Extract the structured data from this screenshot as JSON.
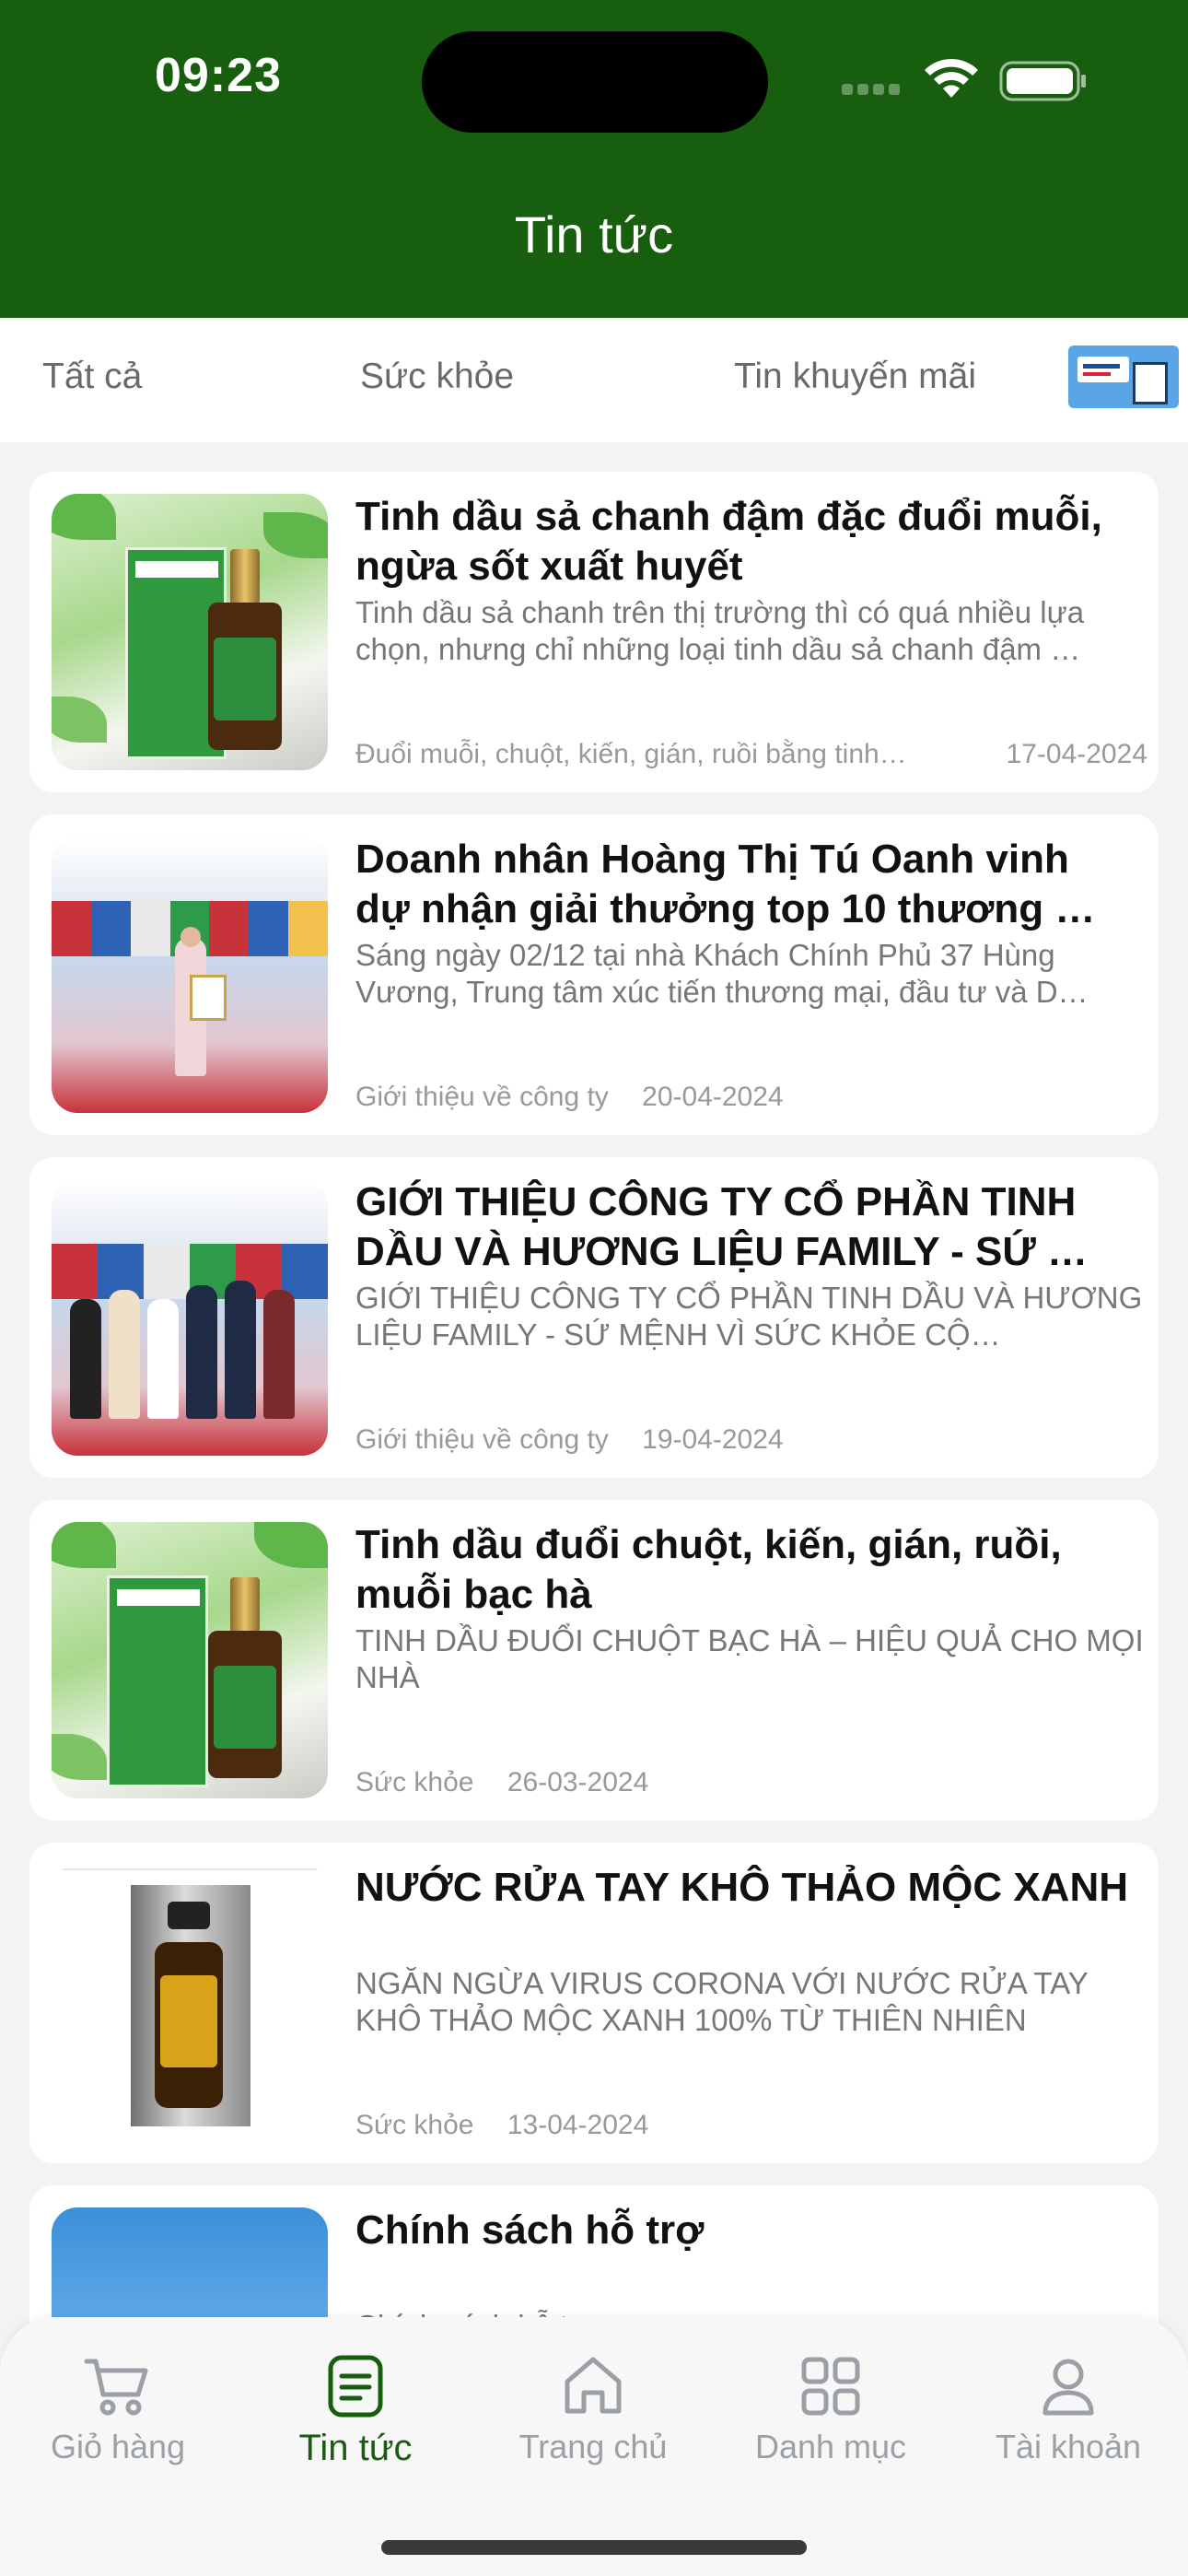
{
  "status_bar": {
    "time": "09:23"
  },
  "header": {
    "title": "Tin tức"
  },
  "tabs": {
    "all": "Tất cả",
    "health": "Sức khỏe",
    "promo": "Tin khuyến mãi"
  },
  "articles": [
    {
      "title": "Tinh dầu sả chanh đậm đặc đuổi muỗi, ngừa sốt xuất huyết",
      "summary": "Tinh dầu sả chanh trên thị trường thì có quá nhiều lựa chọn, nhưng chỉ những loại tinh dầu sả chanh đậm …",
      "category": "Đuổi muỗi, chuột, kiến, gián, ruồi bằng tinh…",
      "date": "17-04-2024"
    },
    {
      "title": "Doanh nhân Hoàng Thị Tú Oanh vinh dự nhận giải thưởng top 10 thương …",
      "summary": "Sáng ngày 02/12 tại  nhà Khách Chính Phủ 37 Hùng Vương, Trung tâm xúc tiến thương mại, đầu tư và D…",
      "category": "Giới thiệu về công ty",
      "date": "20-04-2024"
    },
    {
      "title": "GIỚI THIỆU CÔNG TY CỔ PHẦN TINH DẦU VÀ HƯƠNG LIỆU FAMILY - SỨ …",
      "summary": "GIỚI THIỆU CÔNG TY CỔ PHẦN TINH DẦU VÀ HƯƠNG LIỆU FAMILY - SỨ MỆNH VÌ SỨC KHỎE CỘ…",
      "category": "Giới thiệu về công ty",
      "date": "19-04-2024"
    },
    {
      "title": "Tinh dầu đuổi chuột, kiến, gián, ruồi, muỗi bạc hà",
      "summary": "TINH DẦU ĐUỔI CHUỘT BẠC HÀ – HIỆU QUẢ CHO MỌI NHÀ",
      "category": "Sức khỏe",
      "date": "26-03-2024"
    },
    {
      "title": "NƯỚC RỬA TAY KHÔ THẢO MỘC XANH",
      "summary": "NGĂN NGỪA VIRUS CORONA VỚI NƯỚC RỬA TAY KHÔ THẢO MỘC XANH 100% TỪ THIÊN NHIÊN",
      "category": "Sức khỏe",
      "date": "13-04-2024"
    },
    {
      "title": "Chính sách hỗ trợ",
      "summary": "Chính sách hỗ trợ",
      "category": "",
      "date": ""
    }
  ],
  "bottom_nav": {
    "cart": "Giỏ hàng",
    "news": "Tin tức",
    "home": "Trang chủ",
    "category": "Danh mục",
    "account": "Tài khoản"
  },
  "colors": {
    "brand_green": "#175e0f",
    "active_tab": "#175e0f",
    "inactive": "#9aa0a6"
  }
}
